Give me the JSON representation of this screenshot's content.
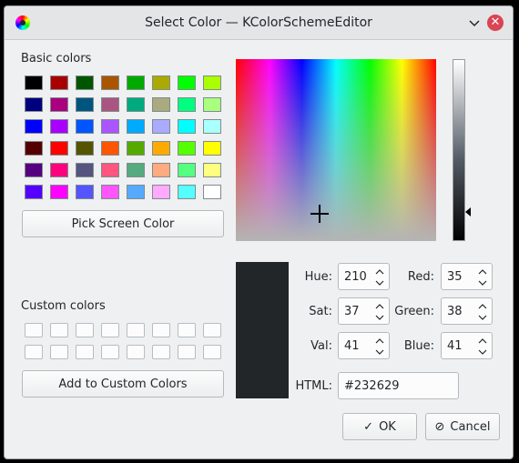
{
  "window": {
    "title": "Select Color — KColorSchemeEditor"
  },
  "basic": {
    "label": "Basic colors",
    "colors": [
      [
        "#000000",
        "#aa0000",
        "#005500",
        "#aa5500",
        "#00aa00",
        "#aaaa00",
        "#00ff00",
        "#aaff00"
      ],
      [
        "#00007f",
        "#aa007f",
        "#00557f",
        "#aa557f",
        "#00aa7f",
        "#aaaa7f",
        "#00ff7f",
        "#aaff7f"
      ],
      [
        "#0000ff",
        "#aa00ff",
        "#0055ff",
        "#aa55ff",
        "#00aaff",
        "#aaaaff",
        "#00ffff",
        "#aaffff"
      ],
      [
        "#550000",
        "#ff0000",
        "#555500",
        "#ff5500",
        "#55aa00",
        "#ffaa00",
        "#55ff00",
        "#ffff00"
      ],
      [
        "#55007f",
        "#ff007f",
        "#55557f",
        "#ff557f",
        "#55aa7f",
        "#ffaa7f",
        "#55ff7f",
        "#ffff7f"
      ],
      [
        "#5500ff",
        "#ff00ff",
        "#5555ff",
        "#ff55ff",
        "#55aaff",
        "#ffaaff",
        "#55ffff",
        "#ffffff"
      ]
    ]
  },
  "pick_screen_label": "Pick Screen Color",
  "custom": {
    "label": "Custom colors",
    "add_label": "Add to Custom Colors"
  },
  "fields": {
    "hue": {
      "label": "Hue:",
      "value": "210"
    },
    "sat": {
      "label": "Sat:",
      "value": "37"
    },
    "val": {
      "label": "Val:",
      "value": "41"
    },
    "red": {
      "label": "Red:",
      "value": "35"
    },
    "green": {
      "label": "Green:",
      "value": "38"
    },
    "blue": {
      "label": "Blue:",
      "value": "41"
    },
    "html": {
      "label": "HTML:",
      "value": "#232629"
    }
  },
  "current_color": "#232629",
  "buttons": {
    "ok": "OK",
    "cancel": "Cancel"
  }
}
